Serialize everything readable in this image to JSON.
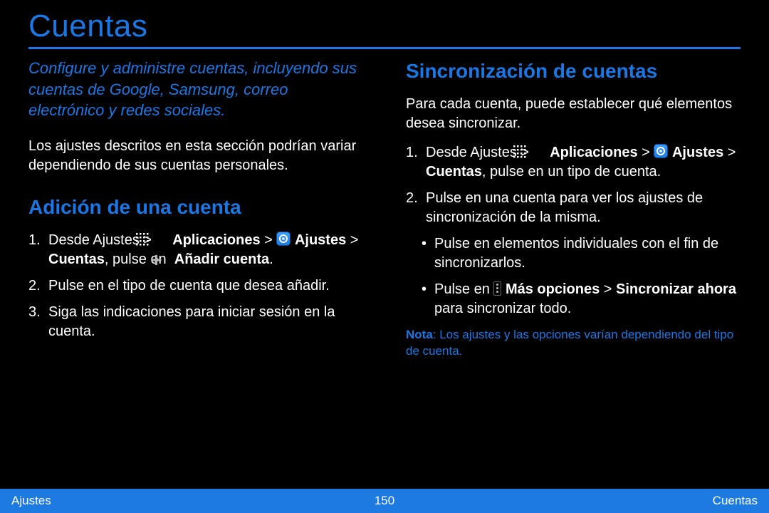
{
  "title": "Cuentas",
  "intro": "Configure y administre cuentas, incluyendo sus cuentas de Google, Samsung, correo electrónico y redes sociales.",
  "caveat": "Los ajustes descritos en esta sección podrían variar dependiendo de sus cuentas personales.",
  "add": {
    "heading": "Adición de una cuenta",
    "s1a": "Desde Ajustes > ",
    "s1b": "Aplicaciones",
    "s1c": " > ",
    "s1d": "Ajustes",
    "s1e": " > ",
    "s1f": "Cuentas",
    "s1g": ", pulse en ",
    "s1h": "Añadir cuenta",
    "s1i": ".",
    "s2": "Pulse en el tipo de cuenta que desea añadir.",
    "s3": "Siga las indicaciones para iniciar sesión en la cuenta."
  },
  "sync": {
    "heading": "Sincronización de cuentas",
    "desc": "Para cada cuenta, puede establecer qué elementos desea sincronizar.",
    "s1a": "Desde Ajustes > ",
    "s1b": "Aplicaciones",
    "s1c": " > ",
    "s1d": "Ajustes",
    "s1e": " > ",
    "s1f": "Cuentas",
    "s1g": ", pulse en un tipo de cuenta.",
    "s2": "Pulse en una cuenta para ver los ajustes de sincronización de la misma.",
    "s3": "Pulse en elementos individuales con el fin de sincronizarlos.",
    "s4a": "Pulse en ",
    "s4b": "Más opciones",
    "s4c": " > ",
    "s4d": "Sincronizar ahora",
    "s4e": " para sincronizar todo."
  },
  "note": {
    "label": "Nota",
    "text": ": Los ajustes y las opciones varían dependiendo del tipo de cuenta."
  },
  "footer": {
    "left": "Ajustes",
    "center": "150",
    "right": "Cuentas"
  }
}
